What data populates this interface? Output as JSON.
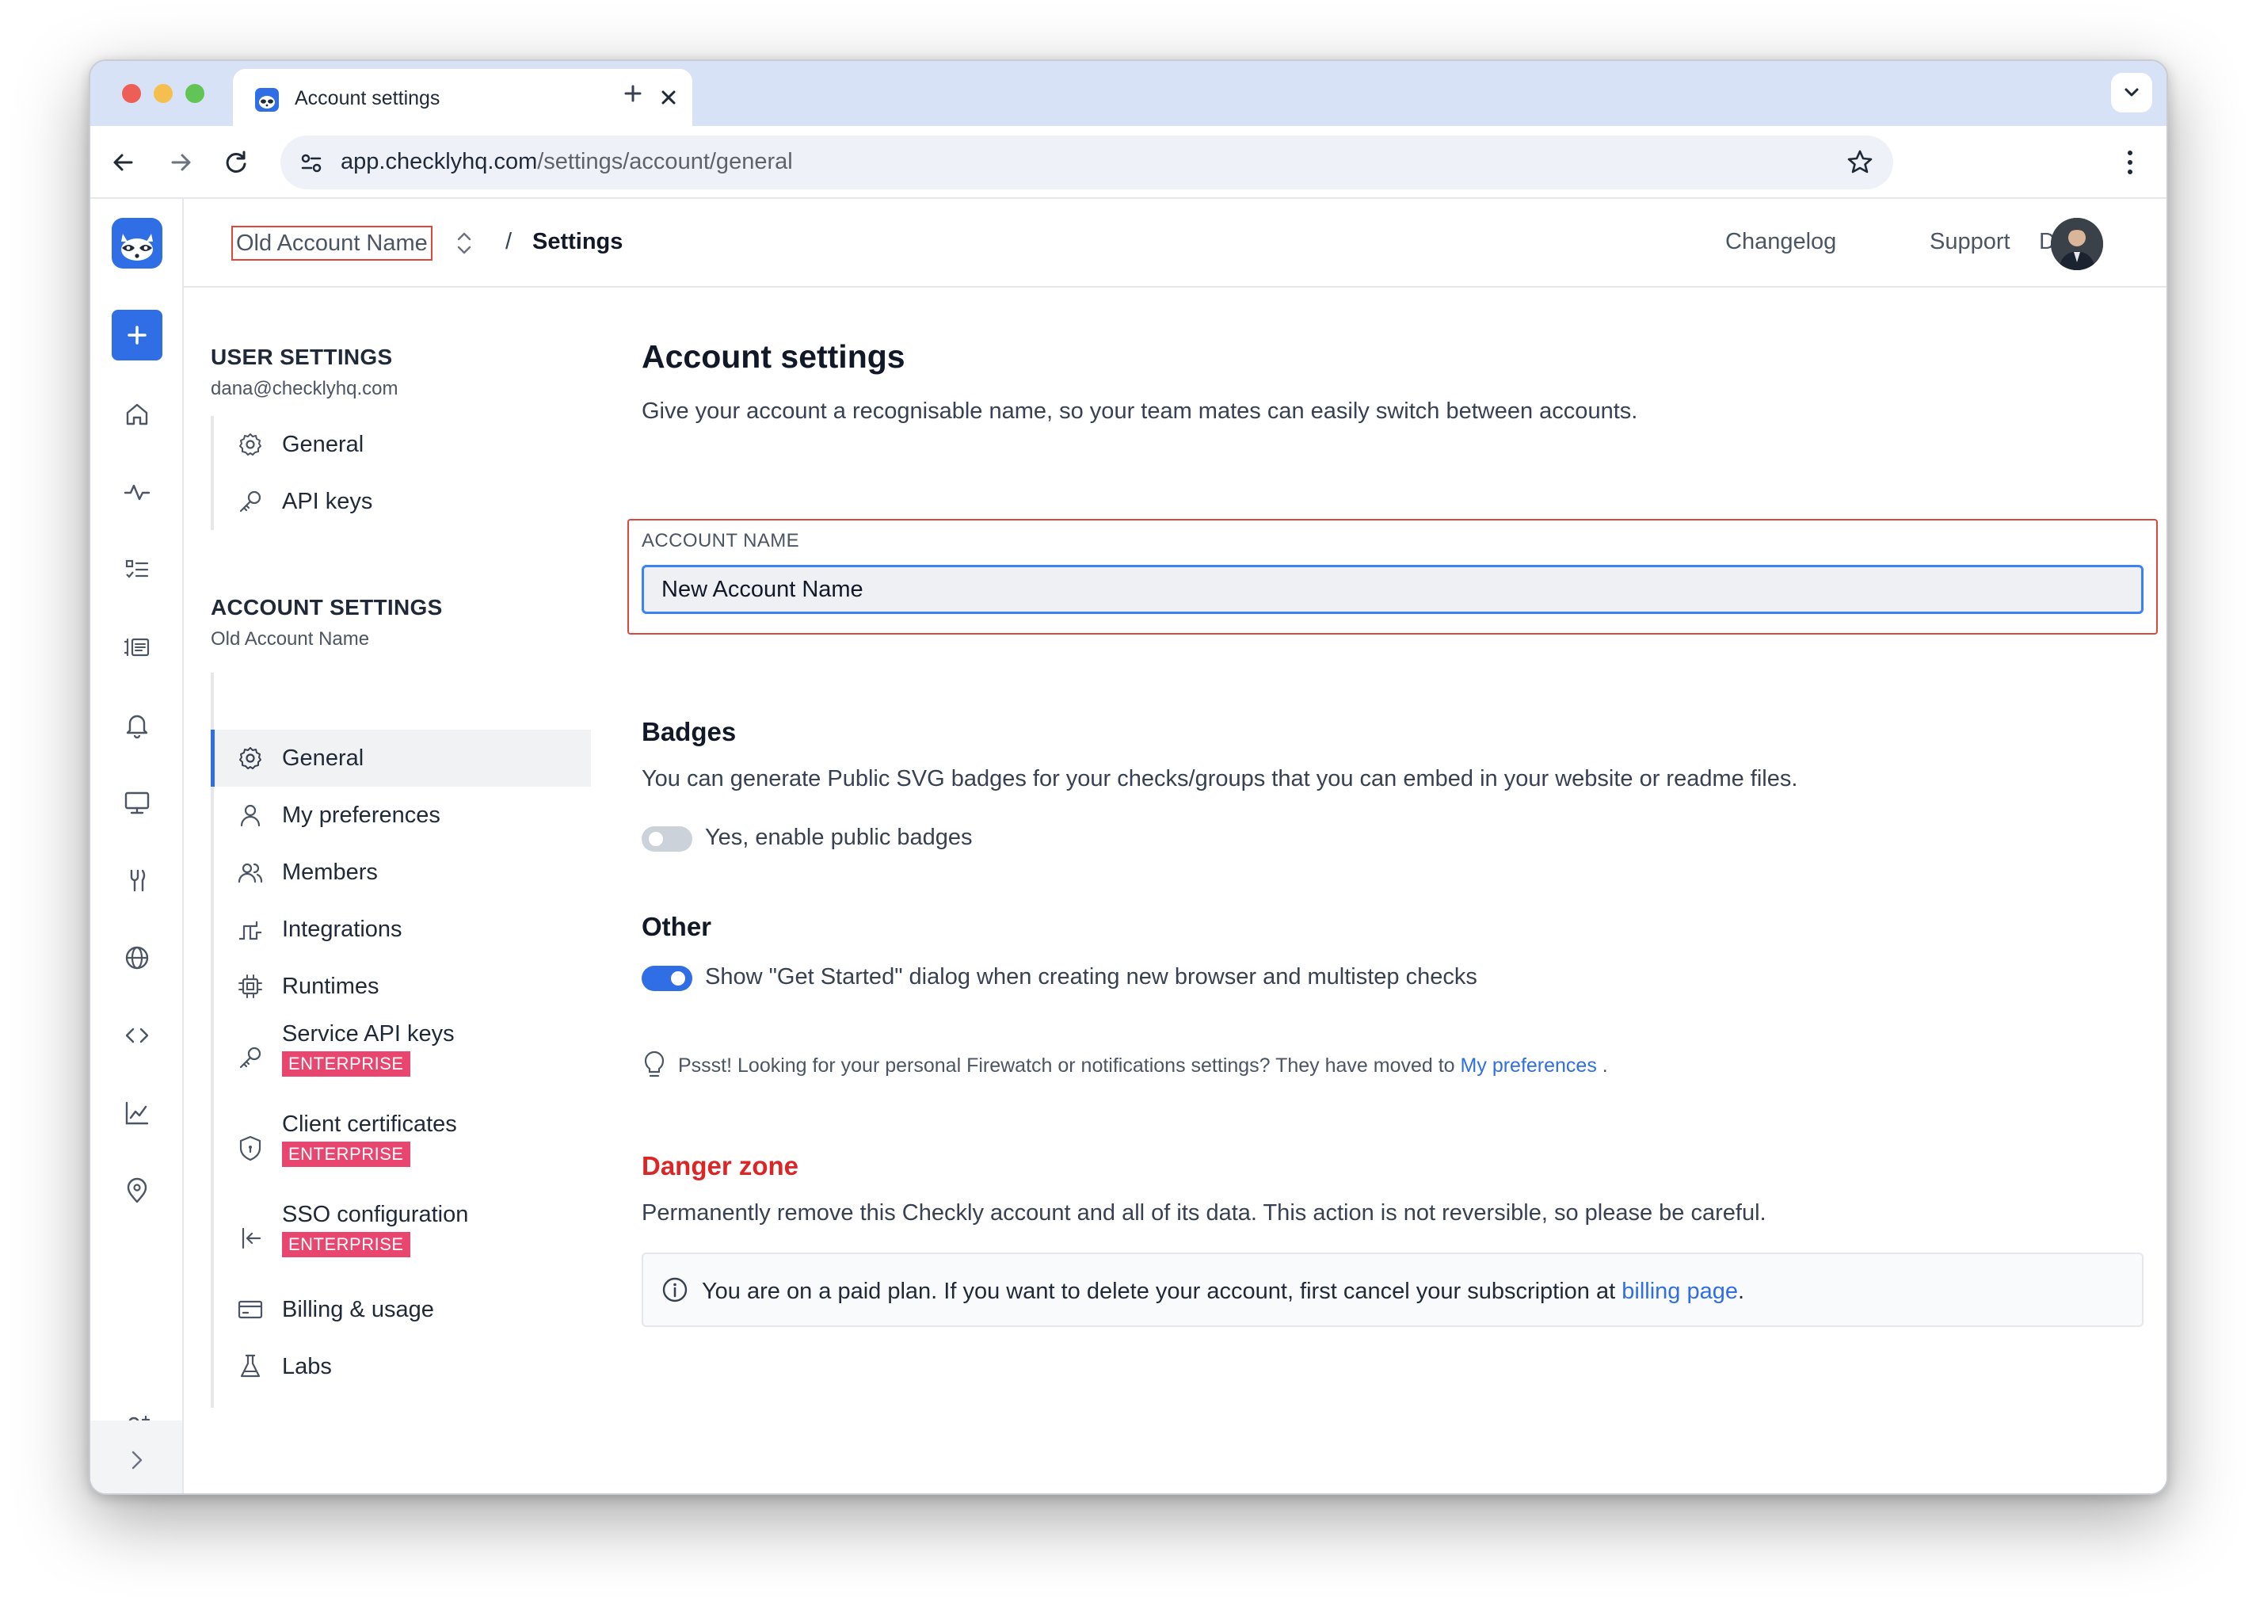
{
  "browser": {
    "tab_title": "Account settings",
    "url_host": "app.checklyhq.com",
    "url_path": "/settings/account/general"
  },
  "topbar": {
    "account_switcher": "Old Account Name",
    "separator": "/",
    "breadcrumb_page": "Settings",
    "links": [
      "Changelog",
      "Support",
      "Docs"
    ]
  },
  "settings_nav": {
    "user_heading": "USER SETTINGS",
    "user_email": "dana@checklyhq.com",
    "user_items": [
      {
        "label": "General",
        "icon": "gear-icon"
      },
      {
        "label": "API keys",
        "icon": "key-icon"
      }
    ],
    "account_heading": "ACCOUNT SETTINGS",
    "account_name": "Old Account Name",
    "account_items": [
      {
        "label": "General",
        "icon": "gear-icon",
        "active": true
      },
      {
        "label": "My preferences",
        "icon": "user-icon"
      },
      {
        "label": "Members",
        "icon": "users-icon"
      },
      {
        "label": "Integrations",
        "icon": "plug-icon"
      },
      {
        "label": "Runtimes",
        "icon": "chip-icon"
      },
      {
        "label": "Service API keys",
        "icon": "key-icon",
        "badge": "ENTERPRISE"
      },
      {
        "label": "Client certificates",
        "icon": "shield-icon",
        "badge": "ENTERPRISE"
      },
      {
        "label": "SSO configuration",
        "icon": "sign-in-icon",
        "badge": "ENTERPRISE"
      },
      {
        "label": "Billing & usage",
        "icon": "credit-card-icon"
      },
      {
        "label": "Labs",
        "icon": "flask-icon"
      }
    ]
  },
  "main": {
    "title": "Account settings",
    "intro": "Give your account a recognisable name, so your team mates can easily switch between accounts.",
    "account_name_label": "ACCOUNT NAME",
    "account_name_value": "New Account Name",
    "badges_heading": "Badges",
    "badges_description": "You can generate Public SVG badges for your checks/groups that you can embed in your website or readme files.",
    "badges_toggle_label": "Yes, enable public badges",
    "badges_toggle_on": false,
    "other_heading": "Other",
    "get_started_toggle_label": "Show \"Get Started\" dialog when creating new browser and multistep checks",
    "get_started_toggle_on": true,
    "tip_text": "Pssst! Looking for your personal Firewatch or notifications settings? They have moved to",
    "tip_link": "My preferences",
    "tip_end": " .",
    "danger_heading": "Danger zone",
    "danger_description": "Permanently remove this Checkly account and all of its data. This action is not reversible, so please be careful.",
    "danger_notice": "You are on a paid plan. If you want to delete your account, first cancel your subscription at",
    "danger_notice_link": "billing page",
    "danger_notice_end": "."
  },
  "colors": {
    "accent": "#2f6ee5",
    "danger": "#dc2626",
    "enterprise_badge": "#e8456f",
    "highlight_outline": "#e0473b"
  }
}
